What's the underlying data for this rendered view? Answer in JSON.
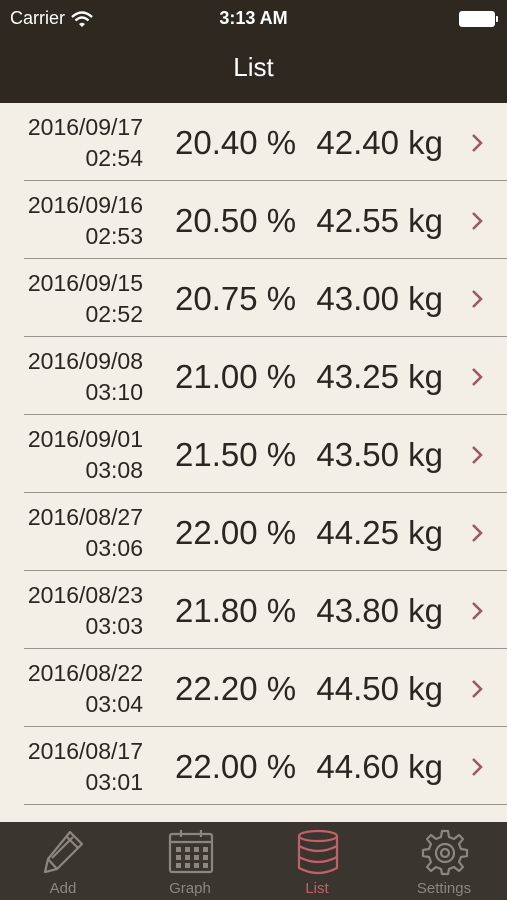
{
  "status_bar": {
    "carrier": "Carrier",
    "time": "3:13 AM"
  },
  "header": {
    "title": "List"
  },
  "entries": [
    {
      "date": "2016/09/17",
      "time": "02:54",
      "percent": "20.40 %",
      "weight": "42.40 kg"
    },
    {
      "date": "2016/09/16",
      "time": "02:53",
      "percent": "20.50 %",
      "weight": "42.55 kg"
    },
    {
      "date": "2016/09/15",
      "time": "02:52",
      "percent": "20.75 %",
      "weight": "43.00 kg"
    },
    {
      "date": "2016/09/08",
      "time": "03:10",
      "percent": "21.00 %",
      "weight": "43.25 kg"
    },
    {
      "date": "2016/09/01",
      "time": "03:08",
      "percent": "21.50 %",
      "weight": "43.50 kg"
    },
    {
      "date": "2016/08/27",
      "time": "03:06",
      "percent": "22.00 %",
      "weight": "44.25 kg"
    },
    {
      "date": "2016/08/23",
      "time": "03:03",
      "percent": "21.80 %",
      "weight": "43.80 kg"
    },
    {
      "date": "2016/08/22",
      "time": "03:04",
      "percent": "22.20 %",
      "weight": "44.50 kg"
    },
    {
      "date": "2016/08/17",
      "time": "03:01",
      "percent": "22.00 %",
      "weight": "44.60 kg"
    }
  ],
  "tabs": [
    {
      "label": "Add",
      "icon": "pencil-icon"
    },
    {
      "label": "Graph",
      "icon": "calendar-icon"
    },
    {
      "label": "List",
      "icon": "database-icon",
      "active": true
    },
    {
      "label": "Settings",
      "icon": "gear-icon"
    }
  ],
  "colors": {
    "nav": "#2e2820",
    "background": "#f3efe7",
    "accent": "#c0616a",
    "tabbar": "#3b3530"
  }
}
